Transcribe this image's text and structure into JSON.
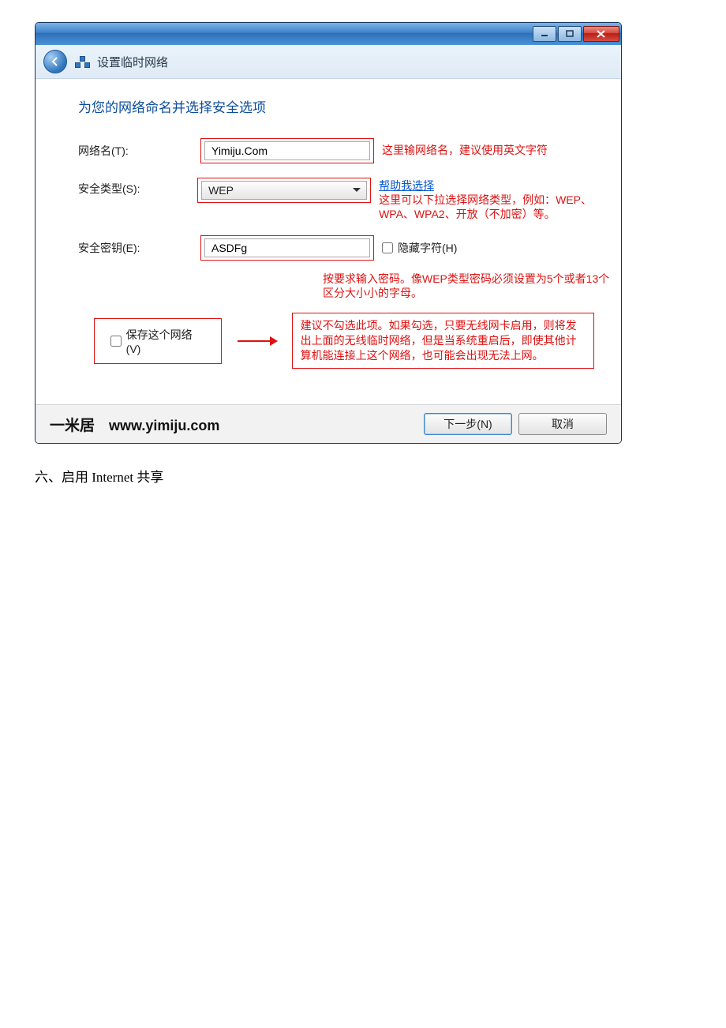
{
  "window": {
    "title": "设置临时网络"
  },
  "form": {
    "section_title": "为您的网络命名并选择安全选项",
    "network_name_label": "网络名(T):",
    "network_name_value": "Yimiju.Com",
    "network_name_annot": "这里输网络名，建议使用英文字符",
    "security_type_label": "安全类型(S):",
    "security_type_value": "WEP",
    "help_link": "帮助我选择",
    "security_type_annot": "这里可以下拉选择网络类型，例如：WEP、WPA、WPA2、开放（不加密）等。",
    "security_key_label": "安全密钥(E):",
    "security_key_value": "ASDFg",
    "hide_chars_label": "隐藏字符(H)",
    "password_note": "按要求输入密码。像WEP类型密码必须设置为5个或者13个区分大小小的字母。",
    "save_network_label": "保存这个网络(V)",
    "save_annot": "建议不勾选此项。如果勾选，只要无线网卡启用，则将发出上面的无线临时网络，但是当系统重启后，即使其他计算机能连接上这个网络，也可能会出现无法上网。"
  },
  "footer": {
    "brand_cn": "一米居",
    "brand_url": "www.yimiju.com",
    "next": "下一步(N)",
    "cancel": "取消"
  },
  "caption": "六、启用 Internet 共享"
}
